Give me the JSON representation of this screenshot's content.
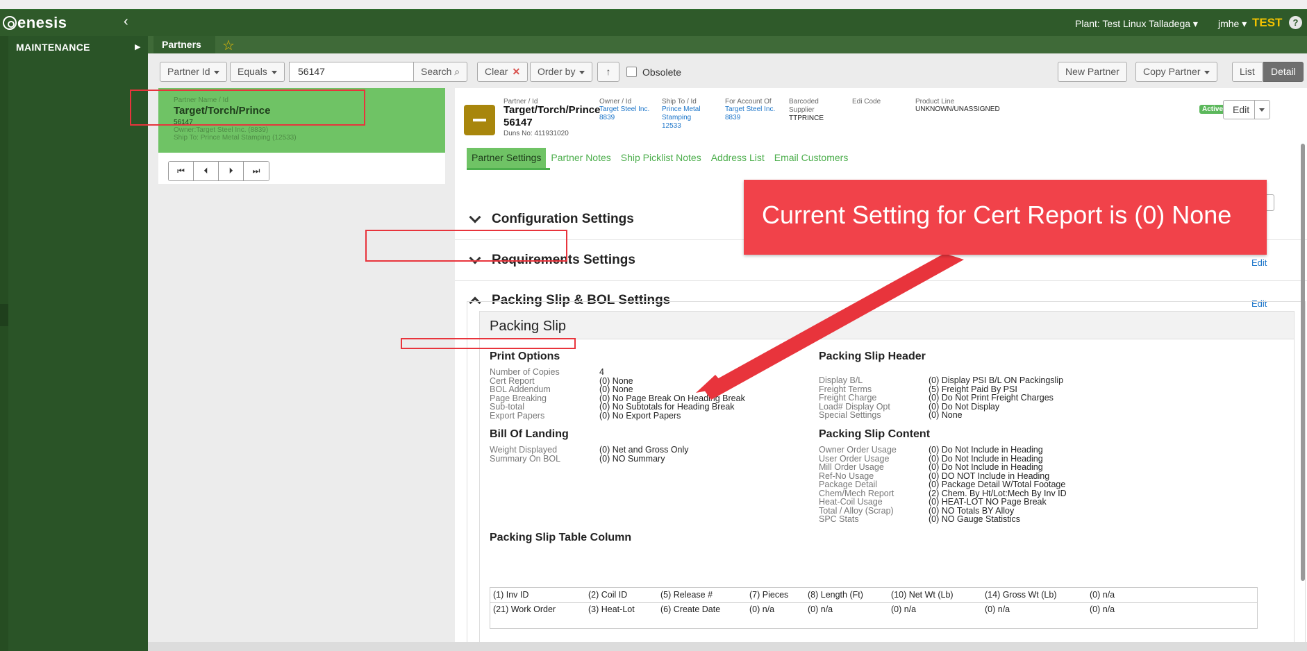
{
  "app": {
    "logo_text": "enesis",
    "plant": "Plant: Test Linux Talladega",
    "user": "jmhe",
    "env": "TEST",
    "help": "?"
  },
  "nav": {
    "section": "MAINTENANCE"
  },
  "tabs": {
    "partners": "Partners"
  },
  "toolbar": {
    "field": "Partner Id",
    "operator": "Equals",
    "search_value": "56147",
    "search_label": "Search",
    "clear_label": "Clear",
    "order_by_label": "Order by",
    "obsolete_label": "Obsolete",
    "new_partner_label": "New Partner",
    "copy_partner_label": "Copy Partner",
    "list_label": "List",
    "detail_label": "Detail"
  },
  "list": {
    "item": {
      "label": "Partner Name / Id",
      "name": "Target/Torch/Prince",
      "id": "56147",
      "owner": "Owner:Target Steel Inc. (8839)",
      "ship_to": "Ship To: Prince Metal Stamping (12533)"
    }
  },
  "detail": {
    "partner_label": "Partner / Id",
    "partner_name": "Target/Torch/Prince",
    "partner_id": "56147",
    "duns": "Duns No: 411931020",
    "owner_label": "Owner / Id",
    "owner_name": "Target Steel Inc.",
    "owner_id": "8839",
    "ship_label": "Ship To / Id",
    "ship_name1": "Prince Metal",
    "ship_name2": "Stamping",
    "ship_id": "12533",
    "account_label": "For Account Of",
    "account_name": "Target Steel Inc.",
    "account_id": "8839",
    "barcoded_label1": "Barcoded",
    "barcoded_label2": "Supplier",
    "barcoded_value": "TTPRINCE",
    "edi_label": "Edi Code",
    "product_label": "Product Line",
    "product_value": "UNKNOWN/UNASSIGNED",
    "status": "Active",
    "edit_label": "Edit"
  },
  "subtabs": [
    "Partner Settings",
    "Partner Notes",
    "Ship Picklist Notes",
    "Address List",
    "Email Customers"
  ],
  "sections": {
    "config": "Configuration Settings",
    "requirements": "Requirements Settings",
    "packing": "Packing Slip & BOL Settings",
    "edit_link": "Edit"
  },
  "packing_slip": {
    "title": "Packing Slip",
    "print_options_title": "Print Options",
    "print_options": [
      {
        "label": "Number of Copies",
        "value": "4"
      },
      {
        "label": "Cert Report",
        "value": "(0) None"
      },
      {
        "label": "BOL Addendum",
        "value": "(0) None"
      },
      {
        "label": "Page Breaking",
        "value": "(0) No Page Break On Heading Break"
      },
      {
        "label": "Sub-total",
        "value": "(0) No Subtotals for Heading Break"
      },
      {
        "label": "Export Papers",
        "value": "(0) No Export Papers"
      }
    ],
    "bol_title": "Bill Of Landing",
    "bol": [
      {
        "label": "Weight Displayed",
        "value": "(0) Net and Gross Only"
      },
      {
        "label": "Summary On BOL",
        "value": "(0) NO Summary"
      }
    ],
    "header_title": "Packing Slip Header",
    "header": [
      {
        "label": "Display B/L",
        "value": "(0) Display PSI B/L ON Packingslip"
      },
      {
        "label": "Freight Terms",
        "value": "(5) Freight Paid By PSI"
      },
      {
        "label": "Freight Charge",
        "value": "(0) Do Not Print Freight Charges"
      },
      {
        "label": "Load# Display Opt",
        "value": "(0) Do Not Display"
      },
      {
        "label": "Special Settings",
        "value": "(0) None"
      }
    ],
    "content_title": "Packing Slip Content",
    "content": [
      {
        "label": "Owner Order Usage",
        "value": "(0) Do Not Include in Heading"
      },
      {
        "label": "User Order Usage",
        "value": "(0) Do Not Include in Heading"
      },
      {
        "label": "Mill Order Usage",
        "value": "(0) Do Not Include in Heading"
      },
      {
        "label": "Ref-No Usage",
        "value": "(0) DO NOT Include in Heading"
      },
      {
        "label": "Package Detail",
        "value": "(0) Package Detail W/Total Footage"
      },
      {
        "label": "Chem/Mech Report",
        "value": "(2) Chem. By Ht/Lot:Mech By Inv ID"
      },
      {
        "label": "Heat-Coil Usage",
        "value": "(0) HEAT-LOT NO Page Break"
      },
      {
        "label": "Total / Alloy (Scrap)",
        "value": "(0) NO Totals BY Alloy"
      },
      {
        "label": "SPC Stats",
        "value": "(0) NO Gauge Statistics"
      }
    ],
    "table_title": "Packing Slip Table Column",
    "table_row1": [
      "(1) Inv ID",
      "(2) Coil ID",
      "(5) Release #",
      "(7) Pieces",
      "(8) Length (Ft)",
      "(10) Net Wt (Lb)",
      "(14) Gross Wt (Lb)",
      "(0) n/a"
    ],
    "table_row2": [
      "(21) Work Order",
      "(3) Heat-Lot",
      "(6) Create Date",
      "(0) n/a",
      "(0) n/a",
      "(0) n/a",
      "(0) n/a",
      "(0) n/a"
    ]
  },
  "annotation": {
    "callout_text": "Current Setting for Cert Report is (0) None",
    "color": "#e8343c"
  }
}
